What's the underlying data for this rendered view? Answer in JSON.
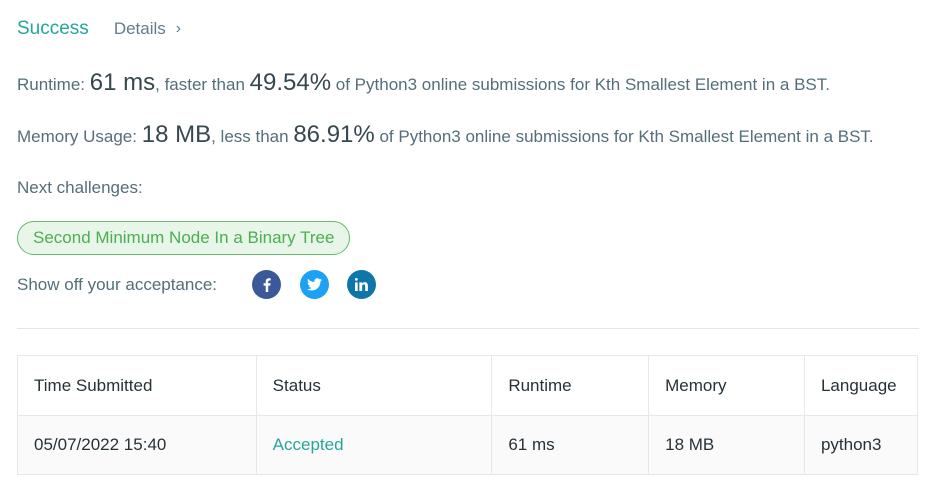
{
  "header": {
    "status": "Success",
    "details_label": "Details",
    "details_chevron": "›"
  },
  "runtime": {
    "label": "Runtime:",
    "value": "61 ms",
    "comparison": ", faster than",
    "percent": "49.54%",
    "suffix": "of Python3 online submissions for Kth Smallest Element in a BST."
  },
  "memory": {
    "label": "Memory Usage:",
    "value": "18 MB",
    "comparison": ", less than",
    "percent": "86.91%",
    "suffix": "of Python3 online submissions for Kth Smallest Element in a BST."
  },
  "next": {
    "label": "Next challenges:",
    "challenges": [
      "Second Minimum Node In a Binary Tree"
    ]
  },
  "share": {
    "label": "Show off your acceptance:",
    "icons": [
      "facebook-icon",
      "twitter-icon",
      "linkedin-icon"
    ]
  },
  "table": {
    "headers": [
      "Time Submitted",
      "Status",
      "Runtime",
      "Memory",
      "Language"
    ],
    "rows": [
      [
        "05/07/2022 15:40",
        "Accepted",
        "61 ms",
        "18 MB",
        "python3"
      ]
    ]
  },
  "colors": {
    "accent": "#26a69a",
    "pill_border": "#66bb6a",
    "pill_bg": "#e8f5e9",
    "facebook": "#3b5998",
    "twitter": "#1da1f2",
    "linkedin": "#0e76a8"
  }
}
